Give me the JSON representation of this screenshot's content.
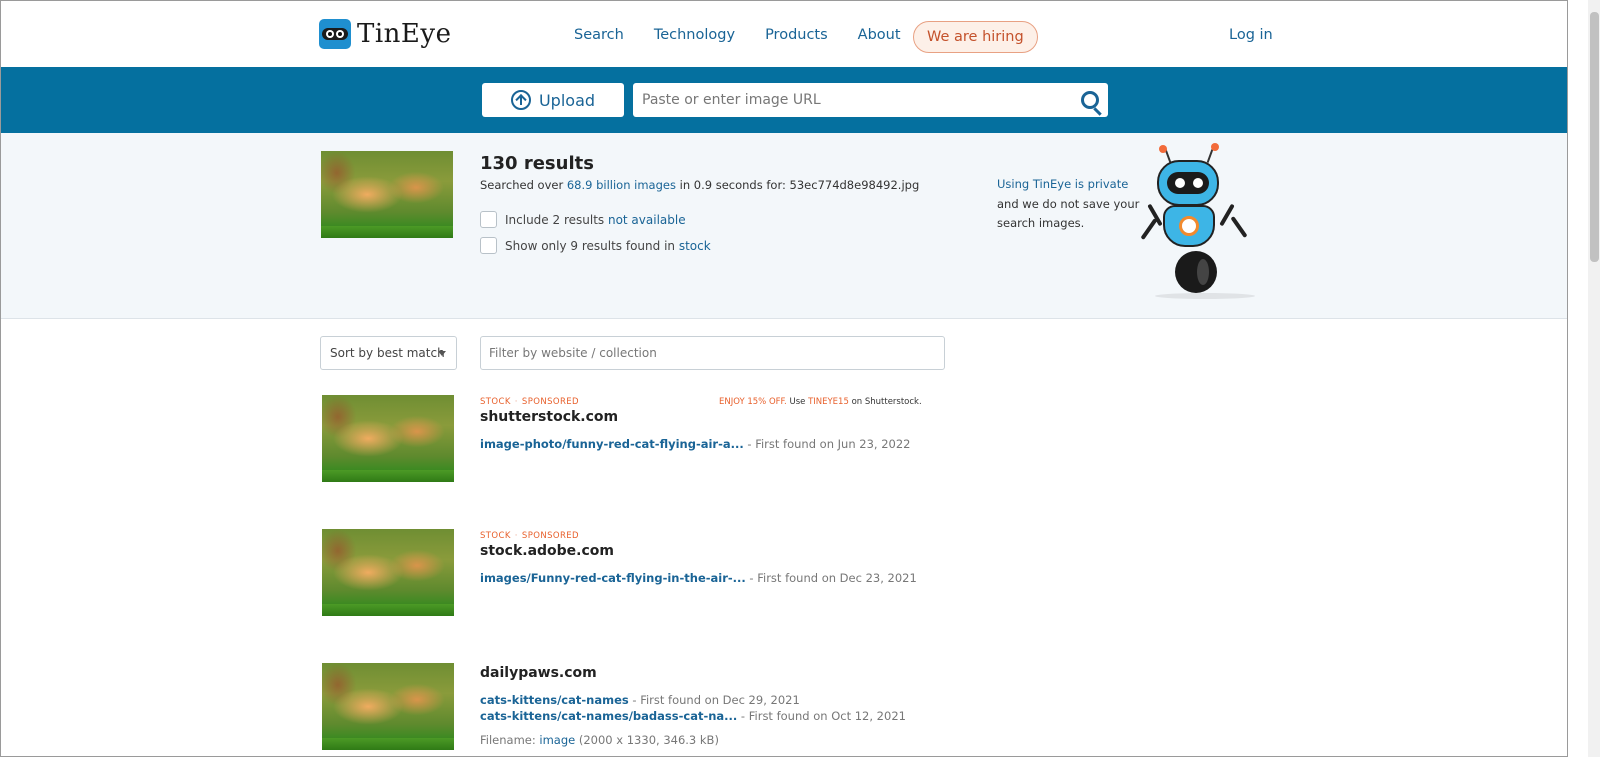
{
  "header": {
    "logo_text": "TinEye",
    "nav": [
      "Search",
      "Technology",
      "Products",
      "About"
    ],
    "hiring": "We are hiring",
    "login": "Log in"
  },
  "searchbar": {
    "upload_label": "Upload",
    "url_placeholder": "Paste or enter image URL"
  },
  "summary": {
    "results_title": "130 results",
    "searched_prefix": "Searched over ",
    "searched_link": "68.9 billion images",
    "searched_mid": " in 0.9 seconds for: ",
    "searched_file": "53ec774d8e98492.jpg",
    "include_prefix": "Include 2 results ",
    "include_link": "not available",
    "stock_prefix": "Show only 9 results found in ",
    "stock_link": "stock",
    "privacy_link": "Using TinEye is private",
    "privacy_text": "and we do not save your search images."
  },
  "filters": {
    "sort_value": "Sort by best match",
    "filter_placeholder": "Filter by website / collection"
  },
  "results": [
    {
      "tag1": "Stock",
      "tag2": "Sponsored",
      "promo_orange1": "Enjoy 15% off.",
      "promo_text1": " Use ",
      "promo_orange2": "TINEYE15",
      "promo_text2": " on Shutterstock.",
      "domain": "shutterstock.com",
      "match_link": "image-photo/funny-red-cat-flying-air-a...",
      "match_text": " - First found on Jun 23, 2022"
    },
    {
      "tag1": "Stock",
      "tag2": "Sponsored",
      "domain": "stock.adobe.com",
      "match_link": "images/Funny-red-cat-flying-in-the-air-...",
      "match_text": " - First found on Dec 23, 2021"
    },
    {
      "domain": "dailypaws.com",
      "match1_link": "cats-kittens/cat-names",
      "match1_text": " - First found on Dec 29, 2021",
      "match2_link": "cats-kittens/cat-names/badass-cat-na...",
      "match2_text": " - First found on Oct 12, 2021",
      "filename_label": "Filename: ",
      "filename_link": "image",
      "filename_meta": " (2000 x 1330, 346.3 kB)"
    }
  ]
}
